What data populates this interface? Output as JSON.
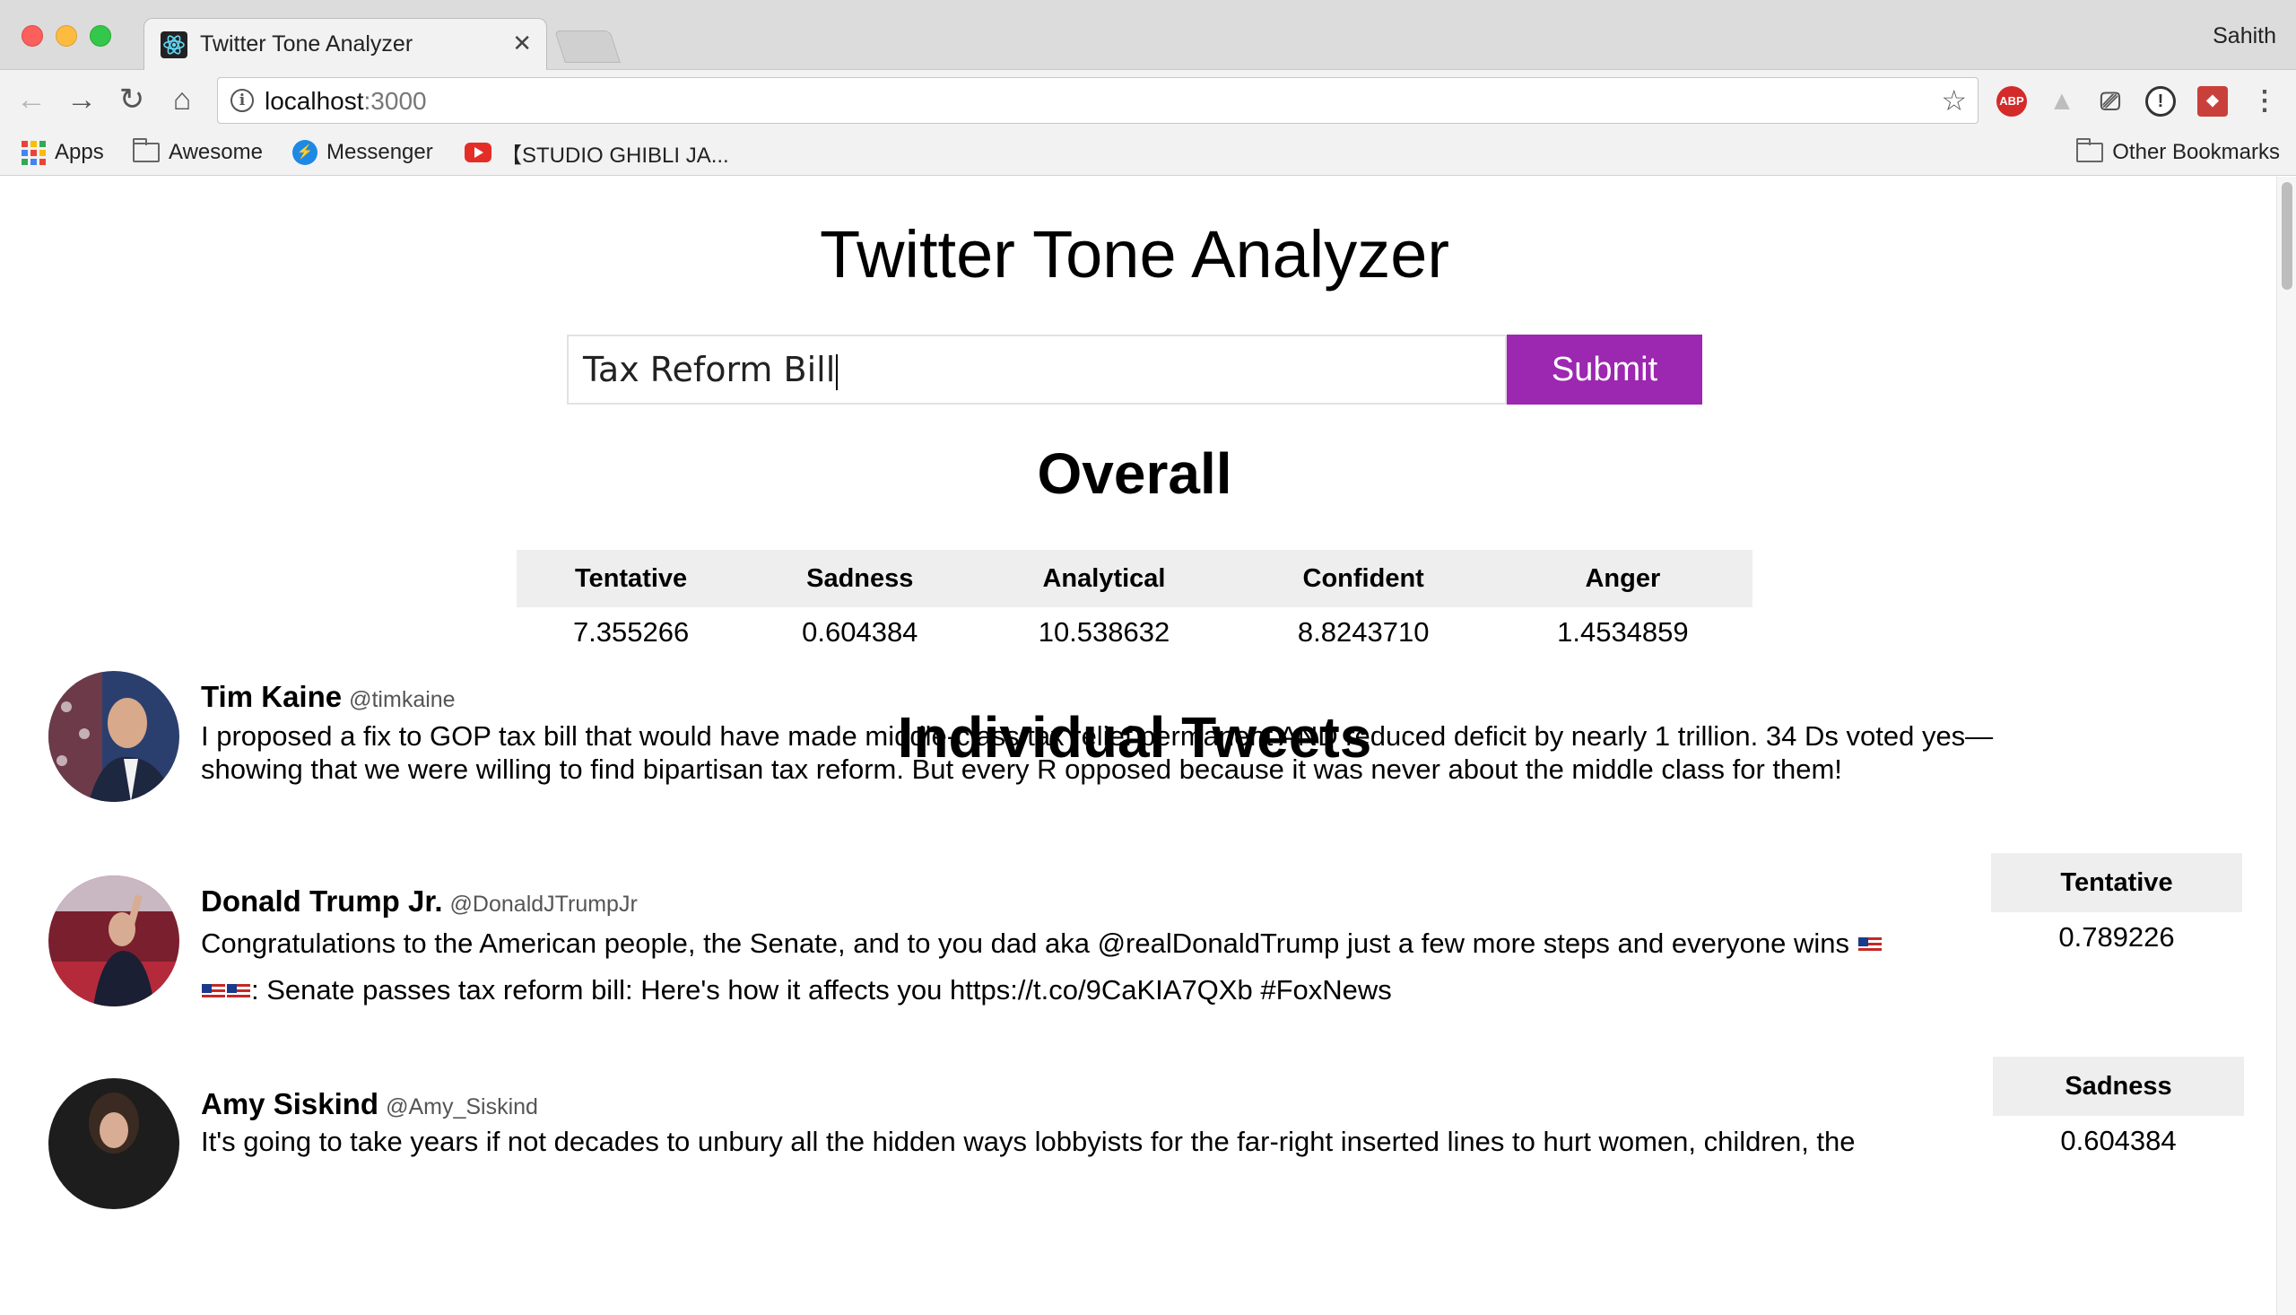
{
  "browser": {
    "tab_title": "Twitter Tone Analyzer",
    "profile_name": "Sahith",
    "url_host": "localhost",
    "url_port": ":3000",
    "bookmarks": [
      "Apps",
      "Awesome",
      "Messenger",
      "【STUDIO GHIBLI JA...",
      "Other Bookmarks"
    ]
  },
  "app": {
    "title": "Twitter Tone Analyzer",
    "search_value": "Tax Reform Bill",
    "submit_label": "Submit"
  },
  "overall": {
    "heading": "Overall",
    "columns": [
      "Tentative",
      "Sadness",
      "Analytical",
      "Confident",
      "Anger"
    ],
    "values": [
      "7.355266",
      "0.604384",
      "10.538632",
      "8.8243710",
      "1.4534859"
    ]
  },
  "individual": {
    "heading": "Individual Tweets",
    "tweets": [
      {
        "name": "Tim Kaine",
        "handle": "@timkaine",
        "text": "I proposed a fix to GOP tax bill that would have made middle-class tax relief permanent AND reduced deficit by nearly 1 trillion. 34 Ds voted yes—showing that we were willing to find bipartisan tax reform. But every R opposed because it was never about the middle class for them!"
      },
      {
        "name": "Donald Trump Jr.",
        "handle": "@DonaldJTrumpJr",
        "text_a": "Congratulations to the American people, the Senate, and to you dad aka @realDonaldTrump just a few more steps and everyone wins",
        "text_b": ": Senate passes tax reform bill: Here's how it affects you https://t.co/9CaKIA7QXb #FoxNews",
        "tone_label": "Tentative",
        "tone_value": "0.789226"
      },
      {
        "name": "Amy Siskind",
        "handle": "@Amy_Siskind",
        "text": "It's going to take years if not decades to unbury all the hidden ways lobbyists for the far-right inserted lines to hurt women, children, the",
        "tone_label": "Sadness",
        "tone_value": "0.604384"
      }
    ]
  },
  "colors": {
    "submit": "#9c27b0",
    "table_header_bg": "#eeeeee"
  }
}
